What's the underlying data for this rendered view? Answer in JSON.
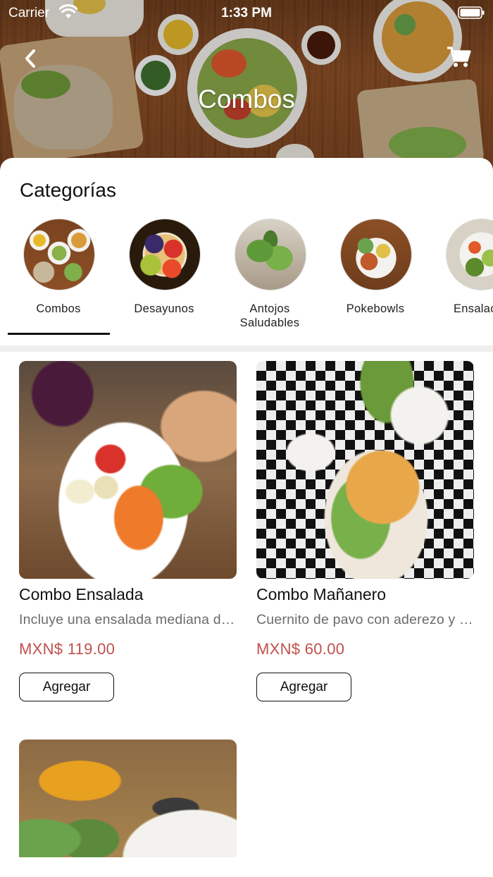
{
  "status_bar": {
    "carrier": "Carrier",
    "time": "1:33 PM"
  },
  "header": {
    "title": "Combos",
    "back_icon": "chevron-left-icon",
    "cart_icon": "shopping-cart-icon"
  },
  "categories_section": {
    "title": "Categorías",
    "selected": "Combos",
    "items": [
      {
        "label": "Combos"
      },
      {
        "label": "Desayunos"
      },
      {
        "label": "Antojos\nSaludables"
      },
      {
        "label": "Pokebowls"
      },
      {
        "label": "Ensalac"
      }
    ]
  },
  "products": [
    {
      "name": "Combo Ensalada",
      "description": "Incluye una ensalada mediana de la casa y agua fresca",
      "price": "MXN$ 119.00",
      "button": "Agregar"
    },
    {
      "name": "Combo Mañanero",
      "description": "Cuernito de pavo con aderezo y café americano",
      "price": "MXN$ 60.00",
      "button": "Agregar"
    }
  ],
  "colors": {
    "price": "#c0504d",
    "indicator": "#111111",
    "divider": "#efefef"
  }
}
